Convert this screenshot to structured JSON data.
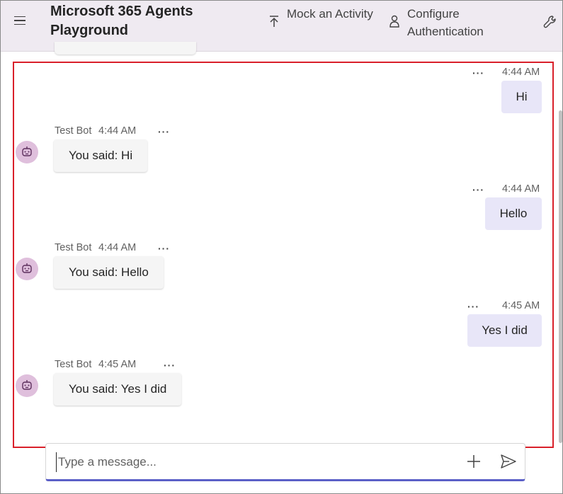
{
  "header": {
    "title": "Microsoft 365 Agents Playground",
    "mock_activity": "Mock an Activity",
    "configure_auth": "Configure Authentication"
  },
  "messages": [
    {
      "sender": "user",
      "time": "4:44 AM",
      "text": "Hi"
    },
    {
      "sender": "bot",
      "name": "Test Bot",
      "time": "4:44 AM",
      "text": "You said: Hi"
    },
    {
      "sender": "user",
      "time": "4:44 AM",
      "text": "Hello"
    },
    {
      "sender": "bot",
      "name": "Test Bot",
      "time": "4:44 AM",
      "text": "You said: Hello"
    },
    {
      "sender": "user",
      "time": "4:45 AM",
      "text": "Yes I did"
    },
    {
      "sender": "bot",
      "name": "Test Bot",
      "time": "4:45 AM",
      "text": "You said: Yes I did"
    }
  ],
  "compose": {
    "placeholder": "Type a message..."
  },
  "icons": {
    "menu": "hamburger-icon",
    "mock": "upload-arrow-icon",
    "auth": "person-lock-icon",
    "tools": "wrench-icon",
    "more": "more-options-icon",
    "avatar": "bot-icon",
    "attach": "plus-icon",
    "send": "send-icon"
  },
  "colors": {
    "header_bg": "#efeaf1",
    "user_bubble": "#e8e6f8",
    "bot_bubble": "#f5f5f5",
    "highlight": "#d9202a",
    "accent": "#5b5fc7",
    "avatar_bg": "#dfbfdc"
  }
}
